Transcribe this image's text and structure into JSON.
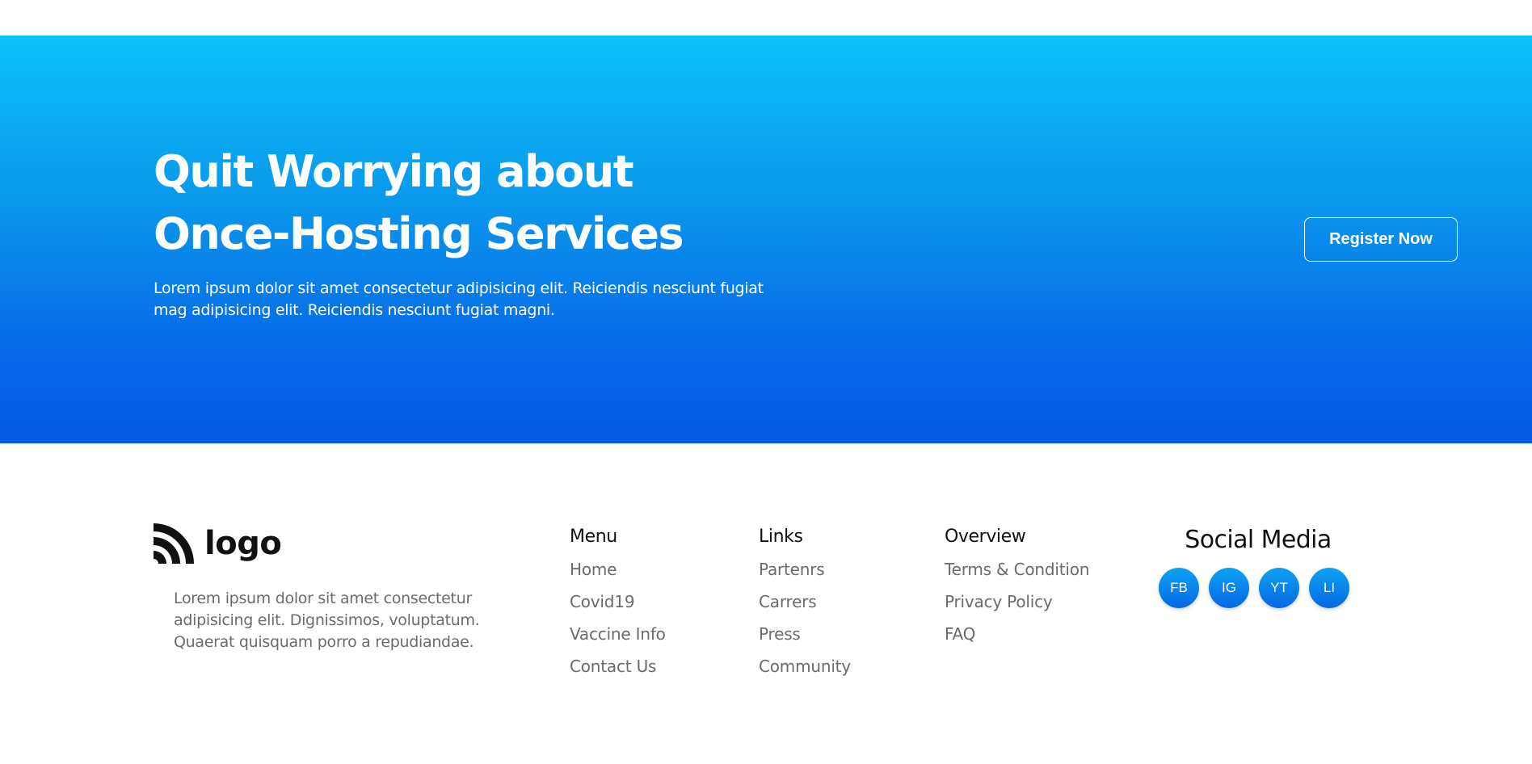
{
  "hero": {
    "title": "Quit Worrying about Once-Hosting Services",
    "description": "Lorem ipsum dolor sit amet consectetur adipisicing elit. Reiciendis nesciunt fugiat mag adipisicing elit. Reiciendis nesciunt fugiat magni.",
    "register_label": "Register Now",
    "gradient_colors": [
      "#0bc2f8",
      "#055ae5"
    ]
  },
  "footer": {
    "logo": {
      "icon": "rss-feed-icon",
      "text": "logo"
    },
    "about": "Lorem ipsum dolor sit amet consectetur adipisicing elit. Dignissimos, voluptatum. Quaerat quisquam porro a repudiandae.",
    "columns": [
      {
        "heading": "Menu",
        "items": [
          "Home",
          "Covid19",
          "Vaccine Info",
          "Contact Us"
        ]
      },
      {
        "heading": "Links",
        "items": [
          "Partenrs",
          "Carrers",
          "Press",
          "Community"
        ]
      },
      {
        "heading": "Overview",
        "items": [
          "Terms & Condition",
          "Privacy Policy",
          "FAQ"
        ]
      }
    ],
    "social": {
      "heading": "Social Media",
      "items": [
        {
          "label": "FB",
          "icon": "facebook-icon"
        },
        {
          "label": "IG",
          "icon": "instagram-icon"
        },
        {
          "label": "YT",
          "icon": "youtube-icon"
        },
        {
          "label": "LI",
          "icon": "linkedin-icon"
        }
      ]
    }
  }
}
